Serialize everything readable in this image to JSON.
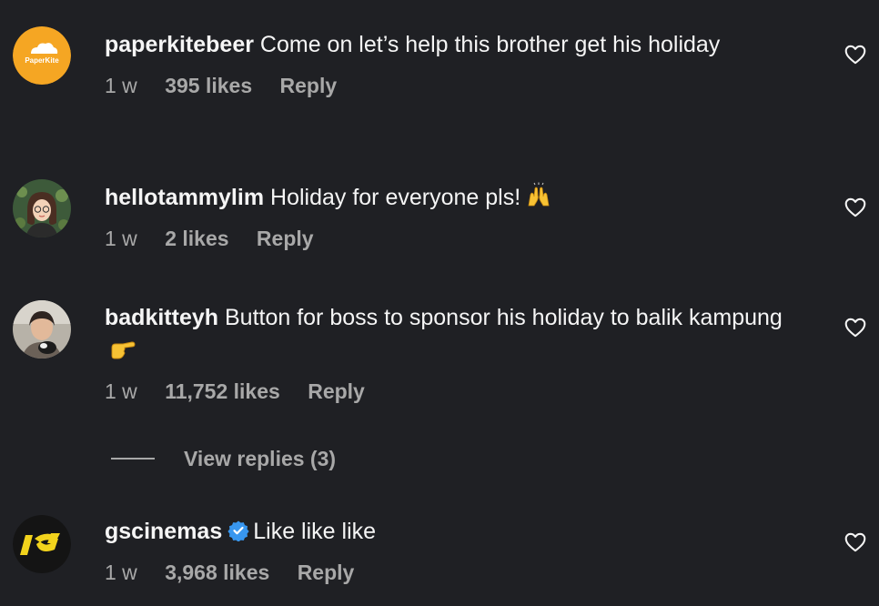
{
  "comments": [
    {
      "username": "paperkitebeer",
      "text": "Come on let’s help this brother get his holiday",
      "avatar_label": "PaperKite",
      "time": "1 w",
      "likes": "395 likes",
      "reply": "Reply",
      "avatar_color": "#f5a623"
    },
    {
      "username": "hellotammylim",
      "text": "Holiday for everyone pls!",
      "emoji": "raising-hands-icon",
      "time": "1 w",
      "likes": "2 likes",
      "reply": "Reply"
    },
    {
      "username": "badkitteyh",
      "text": "Button for boss to sponsor his holiday to balik kampung",
      "emoji": "pointing-hand-icon",
      "time": "1 w",
      "likes": "11,752 likes",
      "reply": "Reply"
    },
    {
      "username": "gscinemas",
      "verified": true,
      "text": "Like like like",
      "time": "1 w",
      "likes": "3,968 likes",
      "reply": "Reply"
    }
  ],
  "view_replies": "View replies (3)",
  "colors": {
    "background": "#1f2024",
    "text": "#f5f5f5",
    "muted": "#a8a8a8",
    "verified": "#3897f0"
  }
}
